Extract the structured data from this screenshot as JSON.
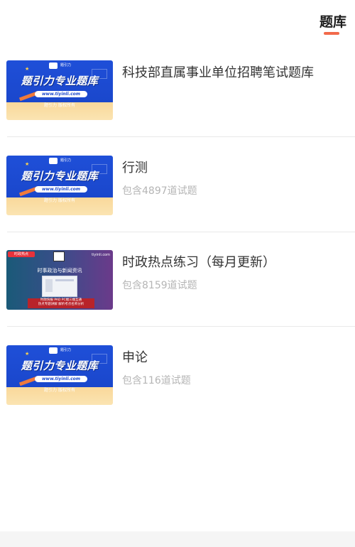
{
  "header": {
    "tab_title": "题库"
  },
  "thumbnails": {
    "promo": {
      "logo_text": "题引力",
      "headline": "题引力专业题库",
      "url": "www.tiyinli.com",
      "footer": "题引力 版权所有"
    },
    "news": {
      "badge": "时政热点",
      "site": "tiyinli.com",
      "headline": "时事政治与新闻资讯",
      "bottom_line1": "时政快报  PAD  PC端三端互通",
      "bottom_line2": "热点专题讲解 解析考点名师分析"
    }
  },
  "banks": [
    {
      "title": "科技部直属事业单位招聘笔试题库",
      "count": ""
    },
    {
      "title": "行测",
      "count": "包含4897道试题"
    },
    {
      "title": "时政热点练习（每月更新）",
      "count": "包含8159道试题"
    },
    {
      "title": "申论",
      "count": "包含116道试题"
    }
  ],
  "colors": {
    "accent": "#f26a4b",
    "title_text": "#333333",
    "muted_text": "#b5b5b5",
    "divider": "#e9e9e9"
  }
}
